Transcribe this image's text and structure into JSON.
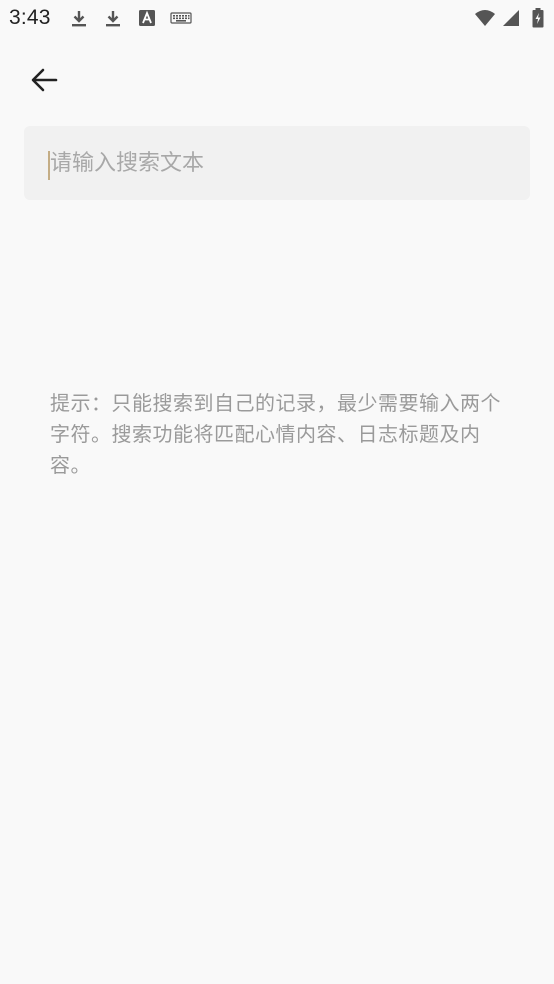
{
  "status_bar": {
    "time": "3:43",
    "icons": [
      "download-icon",
      "download-icon",
      "a-box-icon",
      "keyboard-icon",
      "wifi-icon",
      "signal-icon",
      "battery-icon"
    ]
  },
  "header": {
    "back_icon": "arrow-left-icon"
  },
  "search": {
    "placeholder": "请输入搜索文本",
    "value": ""
  },
  "hint": {
    "text": "提示：只能搜索到自己的记录，最少需要输入两个字符。搜索功能将匹配心情内容、日志标题及内容。"
  },
  "colors": {
    "background": "#f9f9f9",
    "search_background": "#f1f1f1",
    "placeholder": "#a8a8a8",
    "hint_text": "#9a9a9a",
    "caret": "#c4ad85"
  }
}
